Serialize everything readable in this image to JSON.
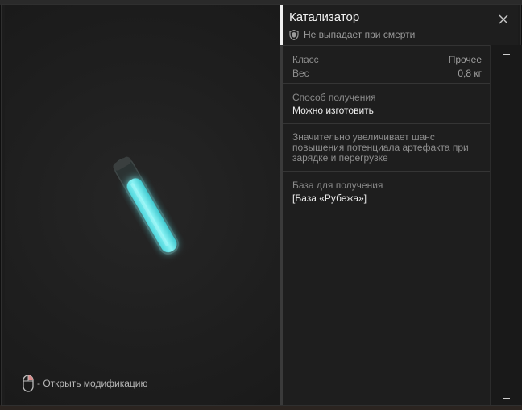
{
  "item": {
    "title": "Катализатор",
    "death_status": "Не выпадает при смерти",
    "stats": [
      {
        "label": "Класс",
        "value": "Прочее"
      },
      {
        "label": "Вес",
        "value": "0,8 кг"
      }
    ],
    "obtain": {
      "label": "Способ получения",
      "value": "Можно изготовить"
    },
    "description": "Значительно увеличивает шанс повышения потенциала артефакта при зарядке и перегрузке",
    "base": {
      "label": "База для получения",
      "value": "[База «Рубежа»]"
    }
  },
  "preview": {
    "hint": "- Открыть модификацию",
    "icon": "mouse-icon"
  },
  "icons": {
    "close": "close-icon",
    "shield": "shield-icon"
  },
  "colors": {
    "liquid": "#5fe3e6",
    "panel": "#1e1e1e",
    "accent": "#f0f0f0"
  }
}
